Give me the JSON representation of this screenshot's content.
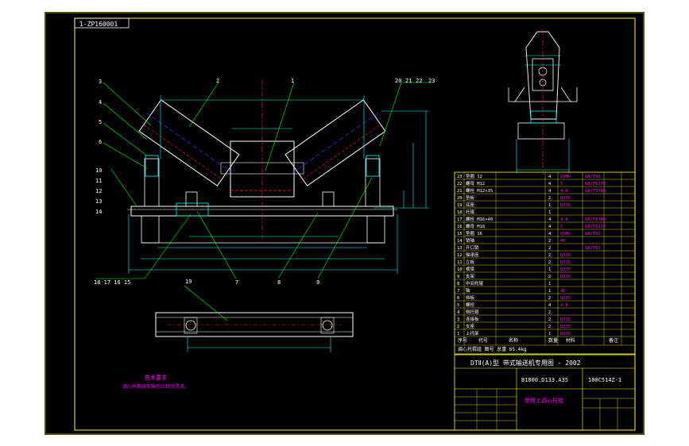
{
  "colors": {
    "background": "#000000",
    "page": "#ffffff",
    "border": "#ffff00",
    "outline": "#ffffff",
    "cyan": "#00ffff",
    "green": "#00ff00",
    "magenta": "#ff00ff",
    "red": "#ff2020",
    "blue": "#3a3aff"
  },
  "drawing": {
    "code_tag": "1-ZP160001"
  },
  "callouts": {
    "top_left": [
      "3",
      "4",
      "5",
      "6"
    ],
    "left_stack": [
      "10",
      "11",
      "12",
      "13",
      "14"
    ],
    "top_mid": [
      "2",
      "1"
    ],
    "top_right": [
      "20",
      "21",
      "22",
      "23"
    ],
    "bottom_left": "18 17 16 15",
    "bottom_mid": [
      "7",
      "8",
      "9"
    ],
    "bottom_view": "19"
  },
  "parts_list": {
    "rows": [
      {
        "no": "23",
        "name": "垫圈 12",
        "qty": "4",
        "material": "65Mn",
        "remark": "GB/T93"
      },
      {
        "no": "22",
        "name": "螺母 M12",
        "qty": "4",
        "material": "5",
        "remark": "GB/T6170"
      },
      {
        "no": "21",
        "name": "螺栓 M12×35",
        "qty": "4",
        "material": "4.8",
        "remark": "GB/T5783"
      },
      {
        "no": "20",
        "name": "垫板",
        "qty": "2",
        "material": "Q235",
        "remark": ""
      },
      {
        "no": "19",
        "name": "底座",
        "qty": "1",
        "material": "Q235",
        "remark": ""
      },
      {
        "no": "18",
        "name": "托辊",
        "qty": "1",
        "material": "",
        "remark": ""
      },
      {
        "no": "17",
        "name": "螺栓 M16×40",
        "qty": "4",
        "material": "4.8",
        "remark": "GB/T5783"
      },
      {
        "no": "16",
        "name": "螺母 M16",
        "qty": "4",
        "material": "5",
        "remark": "GB/T6170"
      },
      {
        "no": "15",
        "name": "垫圈 16",
        "qty": "4",
        "material": "65Mn",
        "remark": "GB/T93"
      },
      {
        "no": "14",
        "name": "销轴",
        "qty": "2",
        "material": "45",
        "remark": ""
      },
      {
        "no": "13",
        "name": "开口销",
        "qty": "2",
        "material": "",
        "remark": "GB/T91"
      },
      {
        "no": "12",
        "name": "轴承座",
        "qty": "2",
        "material": "Q235",
        "remark": ""
      },
      {
        "no": "11",
        "name": "立板",
        "qty": "2",
        "material": "Q235",
        "remark": ""
      },
      {
        "no": "10",
        "name": "横梁",
        "qty": "1",
        "material": "Q235",
        "remark": ""
      },
      {
        "no": "9",
        "name": "支架",
        "qty": "2",
        "material": "Q235",
        "remark": ""
      },
      {
        "no": "8",
        "name": "中间托辊",
        "qty": "1",
        "material": "",
        "remark": ""
      },
      {
        "no": "7",
        "name": "轴",
        "qty": "1",
        "material": "45",
        "remark": ""
      },
      {
        "no": "6",
        "name": "挡板",
        "qty": "2",
        "material": "Q235",
        "remark": ""
      },
      {
        "no": "5",
        "name": "螺栓",
        "qty": "4",
        "material": "4.8",
        "remark": ""
      },
      {
        "no": "4",
        "name": "侧托辊",
        "qty": "2",
        "material": "",
        "remark": ""
      },
      {
        "no": "3",
        "name": "连接板",
        "qty": "2",
        "material": "Q235",
        "remark": ""
      },
      {
        "no": "2",
        "name": "支座",
        "qty": "2",
        "material": "Q235",
        "remark": ""
      },
      {
        "no": "1",
        "name": "上托架",
        "qty": "1",
        "material": "Q235",
        "remark": ""
      }
    ],
    "header": {
      "no": "序号",
      "code": "代号",
      "name": "名称",
      "qty": "数量",
      "material": "材料",
      "remark": "备注"
    },
    "note_row": "调心托辊组 图号 总重 65.4kg"
  },
  "title_block": {
    "line1": "DTⅡ(A)型 带式输送机专用图 - 2002",
    "code": "B1000.D133.A35",
    "drawing_no": "100C514Z-1",
    "name": "摩擦上调心托辊"
  },
  "technical_notes": {
    "heading": "技术要求",
    "line1": "调心托辊组安装后应转动灵活。"
  }
}
